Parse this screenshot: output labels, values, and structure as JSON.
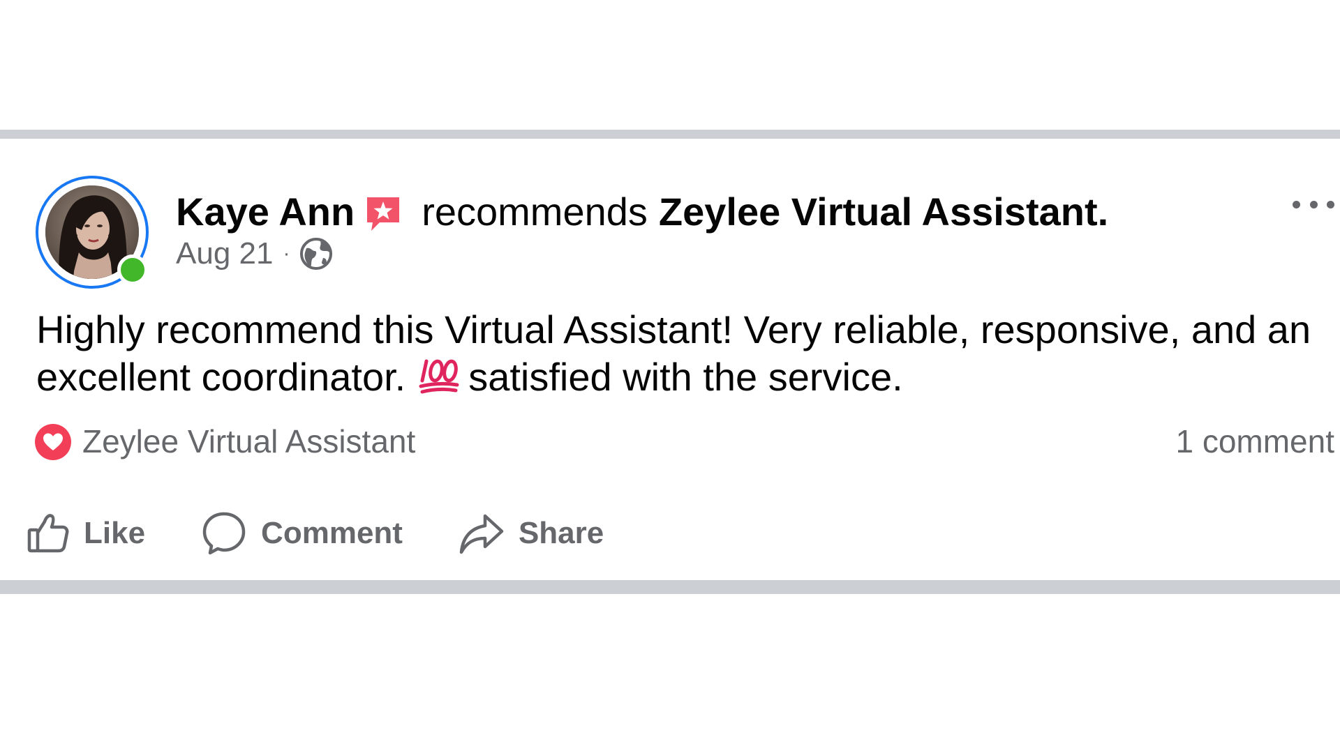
{
  "post": {
    "author": "Kaye Ann",
    "action_text": "recommends",
    "page_name": "Zeylee Virtual Assistant.",
    "date": "Aug 21",
    "separator": "·",
    "privacy_icon": "globe-icon",
    "body_part1": "Highly recommend this Virtual Assistant! Very reliable, responsive, and an excellent coordinator.",
    "body_emoji": "hundred-points-emoji",
    "body_part2": "satisfied with the service.",
    "reaction_icon": "love-icon",
    "reactor_name": "Zeylee Virtual Assistant",
    "comment_count": "1 comment",
    "actions": {
      "like": "Like",
      "comment": "Comment",
      "share": "Share"
    }
  },
  "colors": {
    "accent": "#1877f2",
    "online": "#42b72a",
    "love": "#f33e58",
    "badge": "#f35369",
    "secondary_text": "#65676b",
    "divider": "#ccd0d5"
  }
}
